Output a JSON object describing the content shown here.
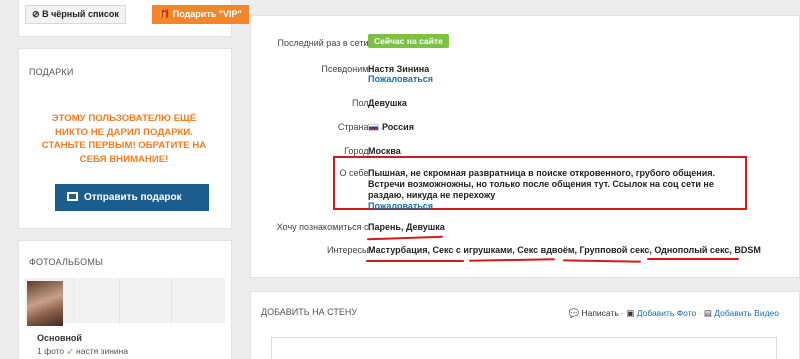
{
  "top_buttons": {
    "blacklist": "В чёрный список",
    "gift_vip": "Подарить \"VIP\""
  },
  "gifts": {
    "title": "ПОДАРКИ",
    "empty_message": "ЭТОМУ ПОЛЬЗОВАТЕЛЮ ЕЩЁ НИКТО НЕ ДАРИЛ ПОДАРКИ. СТАНЬТЕ ПЕРВЫМ! ОБРАТИТЕ НА СЕБЯ ВНИМАНИЕ!",
    "send_button": "Отправить подарок"
  },
  "albums": {
    "title": "ФОТОАЛЬБОМЫ",
    "album_name": "Основной",
    "photo_count": "1 фото",
    "author": "настя зинина"
  },
  "profile": {
    "last_seen_label": "Последний раз в сети:",
    "last_seen_value": "Сейчас на сайте",
    "nickname_label": "Псевдоним:",
    "nickname_value": "Настя Зинина",
    "report_link": "Пожаловаться",
    "gender_label": "Пол:",
    "gender_value": "Девушка",
    "country_label": "Страна:",
    "country_value": "Россия",
    "city_label": "Город:",
    "city_value": "Москва",
    "about_label": "О себе:",
    "about_value": "Пышная, не скромная развратница в поиске откровенного, грубого общения. Встречи возможножны, но только после общения тут. Ссылок на соц сети не раздаю, никуда не перехожу",
    "about_report": "Пожаловаться",
    "want_meet_label": "Хочу познакомиться с:",
    "want_meet_value": "Парень, Девушка",
    "interests_label": "Интересы:",
    "interests_value": "Мастурбация, Секс с игрушками, Секс вдвоём, Групповой секс, Однополый секс, BDSM"
  },
  "wall": {
    "title": "ДОБАВИТЬ НА СТЕНУ",
    "write": "Написать",
    "add_photo": "Добавить Фото",
    "add_video": "Добавить Видео"
  },
  "colors": {
    "accent_orange": "#f4862a",
    "online_green": "#7cc242",
    "link_blue": "#1a6ea8",
    "annotation_red": "#d41919",
    "send_button_blue": "#1b5e8e"
  },
  "icons": [
    "block-icon",
    "gift-icon",
    "chat-icon",
    "photo-icon",
    "video-icon",
    "flag-ru-icon",
    "heart-icon"
  ]
}
